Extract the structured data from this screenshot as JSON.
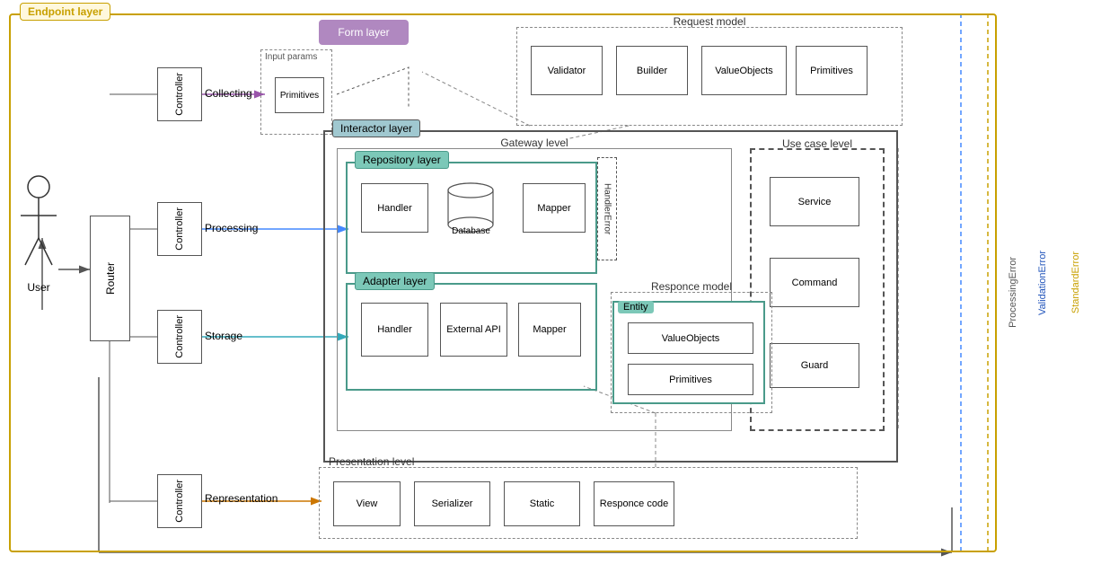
{
  "layers": {
    "endpoint": "Endpoint layer",
    "form": "Form layer",
    "interactor": "Interactor layer",
    "repository": "Repository layer",
    "adapter": "Adapter layer",
    "presentation": "Presentation level",
    "gateway": "Gateway level",
    "usecase": "Use case level"
  },
  "models": {
    "request": "Request model",
    "responce": "Responce model"
  },
  "boxes": {
    "controller": "Controller",
    "router": "Router",
    "user": "User",
    "validator": "Validator",
    "builder": "Builder",
    "valueobjects_req": "ValueObjects",
    "primitives_req": "Primitives",
    "handler_repo": "Handler",
    "database": "Database",
    "mapper_repo": "Mapper",
    "handler_adapter": "Handler",
    "external_api": "External API",
    "mapper_adapter": "Mapper",
    "service": "Service",
    "command": "Command",
    "guard": "Guard",
    "entity": "Entity",
    "valueobjects_entity": "ValueObjects",
    "primitives_entity": "Primitives",
    "view": "View",
    "serializer": "Serializer",
    "static": "Static",
    "responce_code": "Responce code",
    "primitives_input": "Primitives",
    "input_params": "Input params",
    "handler_error": "HandlerError"
  },
  "arrows": {
    "collecting": "Collecting",
    "processing": "Processing",
    "storage": "Storage",
    "representation": "Representation"
  },
  "errors": {
    "processing": "ProcessingError",
    "validation": "ValidationError",
    "standard": "StandardError"
  },
  "colors": {
    "teal": "#4a9a8a",
    "teal_light": "#7cc8b8",
    "purple": "#b088c0",
    "blue_dashed": "#4488ff",
    "orange": "#c8a000",
    "arrow_purple": "#9955aa",
    "arrow_blue": "#4488ff",
    "arrow_teal": "#33aabb",
    "arrow_orange": "#cc7700"
  }
}
